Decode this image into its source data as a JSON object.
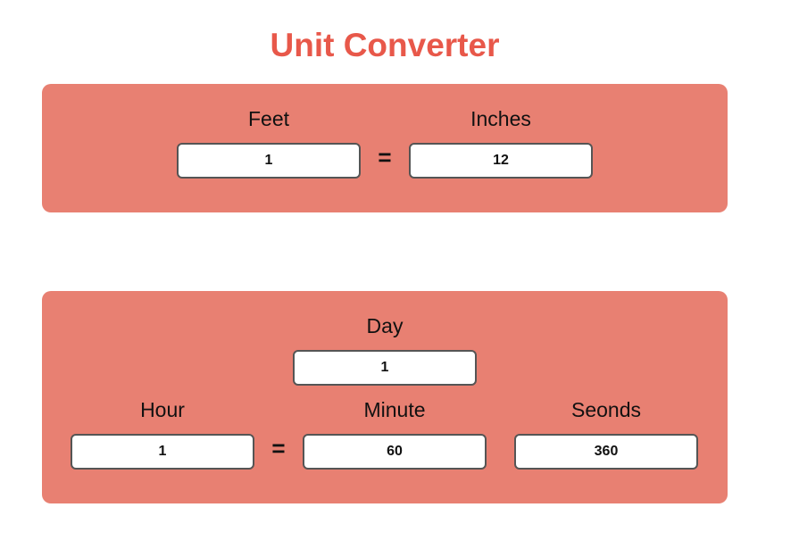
{
  "header": {
    "title": "Unit Converter"
  },
  "length_converter": {
    "from_label": "Feet",
    "to_label": "Inches",
    "from_value": "1",
    "to_value": "12",
    "equals_sign": "="
  },
  "time_converter": {
    "day_label": "Day",
    "day_value": "1",
    "hour_label": "Hour",
    "hour_value": "1",
    "minute_label": "Minute",
    "minute_value": "60",
    "seconds_label": "Seonds",
    "seconds_value": "360",
    "equals_sign": "="
  },
  "colors": {
    "title": "#e8584a",
    "panel": "#e88072",
    "field_border": "#555555"
  }
}
